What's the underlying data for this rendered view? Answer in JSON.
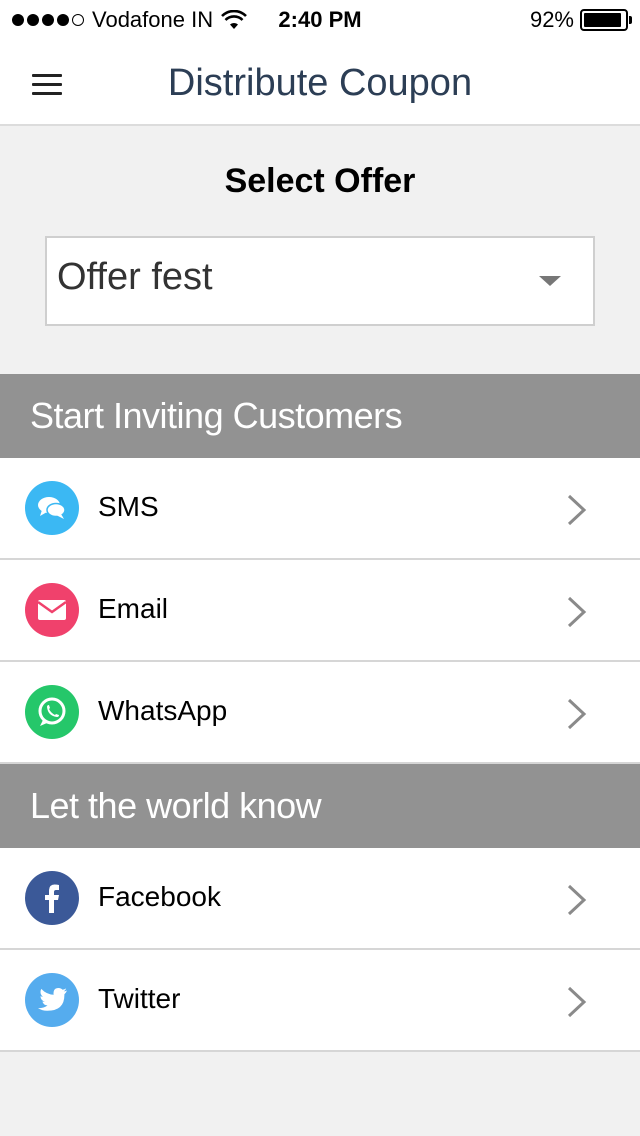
{
  "status_bar": {
    "carrier": "Vodafone IN",
    "time": "2:40 PM",
    "battery_percent": "92%",
    "battery_level": 0.92,
    "signal_bars": 4
  },
  "header": {
    "title": "Distribute Coupon",
    "menu_icon": "hamburger-menu-icon"
  },
  "offer": {
    "heading": "Select Offer",
    "selected_value": "Offer fest"
  },
  "sections": [
    {
      "title": "Start Inviting Customers",
      "items": [
        {
          "label": "SMS",
          "icon": "sms-icon",
          "color": "#3bb8f3"
        },
        {
          "label": "Email",
          "icon": "email-icon",
          "color": "#f0416c"
        },
        {
          "label": "WhatsApp",
          "icon": "whatsapp-icon",
          "color": "#25c76a"
        }
      ]
    },
    {
      "title": "Let the world know",
      "items": [
        {
          "label": "Facebook",
          "icon": "facebook-icon",
          "color": "#3b5998"
        },
        {
          "label": "Twitter",
          "icon": "twitter-icon",
          "color": "#55acee"
        }
      ]
    }
  ]
}
